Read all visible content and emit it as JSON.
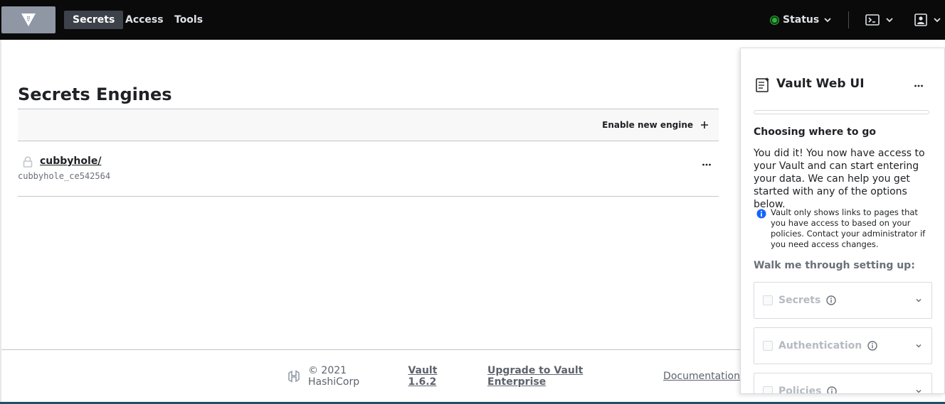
{
  "nav": {
    "items": [
      {
        "label": "Secrets",
        "active": true
      },
      {
        "label": "Access",
        "active": false
      },
      {
        "label": "Tools",
        "active": false
      }
    ],
    "status_label": "Status",
    "status_color": "#2eb039",
    "icons": [
      "vault-logo-icon",
      "terminal-icon",
      "user-icon"
    ]
  },
  "main": {
    "title": "Secrets Engines",
    "enable_label": "Enable new engine",
    "engines": [
      {
        "path": "cubbyhole/",
        "accessor": "cubbyhole_ce542564"
      }
    ]
  },
  "footer": {
    "copyright": "© 2021 HashiCorp",
    "version_link": "Vault 1.6.2",
    "upgrade_link": "Upgrade to Vault Enterprise",
    "docs_link": "Documentation"
  },
  "wizard": {
    "title": "Vault Web UI",
    "progress": 0,
    "heading": "Choosing where to go",
    "body": "You did it! You now have access to your Vault and can start entering your data. We can help you get started with any of the options below.",
    "info": "Vault only shows links to pages that you have access to based on your policies. Contact your administrator if you need access changes.",
    "walk_label": "Walk me through setting up:",
    "options": [
      {
        "label": "Secrets"
      },
      {
        "label": "Authentication"
      },
      {
        "label": "Policies"
      }
    ]
  },
  "colors": {
    "topbar": "#0a0a0a",
    "accent_blue": "#1563ff",
    "footer_strip": "#1f5162"
  }
}
